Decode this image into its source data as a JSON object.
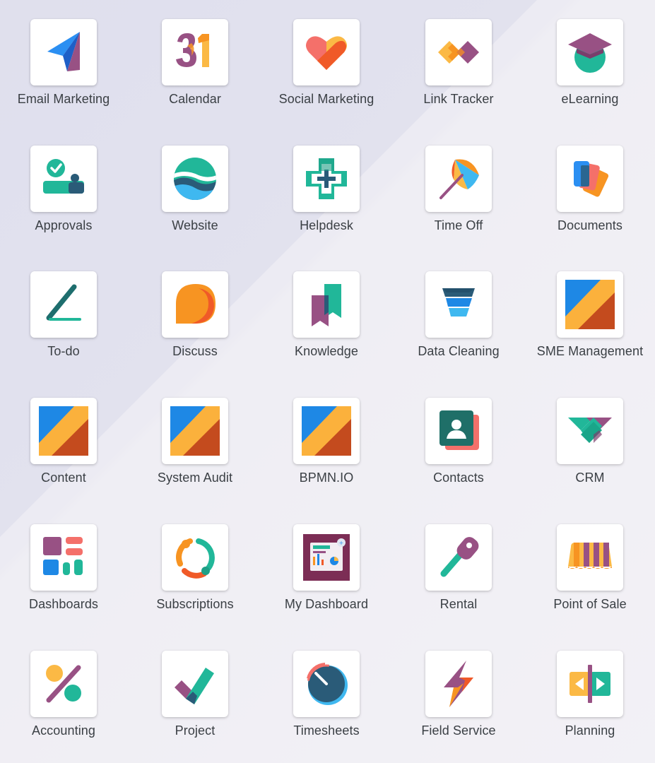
{
  "apps": [
    {
      "label": "Email Marketing",
      "icon": "email-marketing-icon"
    },
    {
      "label": "Calendar",
      "icon": "calendar-icon"
    },
    {
      "label": "Social Marketing",
      "icon": "social-marketing-icon"
    },
    {
      "label": "Link Tracker",
      "icon": "link-tracker-icon"
    },
    {
      "label": "eLearning",
      "icon": "elearning-icon"
    },
    {
      "label": "Approvals",
      "icon": "approvals-icon"
    },
    {
      "label": "Website",
      "icon": "website-icon"
    },
    {
      "label": "Helpdesk",
      "icon": "helpdesk-icon"
    },
    {
      "label": "Time Off",
      "icon": "time-off-icon"
    },
    {
      "label": "Documents",
      "icon": "documents-icon"
    },
    {
      "label": "To-do",
      "icon": "todo-icon"
    },
    {
      "label": "Discuss",
      "icon": "discuss-icon"
    },
    {
      "label": "Knowledge",
      "icon": "knowledge-icon"
    },
    {
      "label": "Data Cleaning",
      "icon": "data-cleaning-icon"
    },
    {
      "label": "SME Management",
      "icon": "sme-management-icon"
    },
    {
      "label": "Content",
      "icon": "content-icon"
    },
    {
      "label": "System Audit",
      "icon": "system-audit-icon"
    },
    {
      "label": "BPMN.IO",
      "icon": "bpmn-io-icon"
    },
    {
      "label": "Contacts",
      "icon": "contacts-icon"
    },
    {
      "label": "CRM",
      "icon": "crm-icon"
    },
    {
      "label": "Dashboards",
      "icon": "dashboards-icon"
    },
    {
      "label": "Subscriptions",
      "icon": "subscriptions-icon"
    },
    {
      "label": "My Dashboard",
      "icon": "my-dashboard-icon"
    },
    {
      "label": "Rental",
      "icon": "rental-icon"
    },
    {
      "label": "Point of Sale",
      "icon": "point-of-sale-icon"
    },
    {
      "label": "Accounting",
      "icon": "accounting-icon"
    },
    {
      "label": "Project",
      "icon": "project-icon"
    },
    {
      "label": "Timesheets",
      "icon": "timesheets-icon"
    },
    {
      "label": "Field Service",
      "icon": "field-service-icon"
    },
    {
      "label": "Planning",
      "icon": "planning-icon"
    }
  ],
  "colors": {
    "label": "#3a3f44",
    "tile": "#ffffff",
    "purple": "#985184",
    "teal": "#21b799",
    "orange": "#f79422",
    "blue": "#1e88e5",
    "yellow": "#fbb945",
    "red": "#c0392b"
  }
}
